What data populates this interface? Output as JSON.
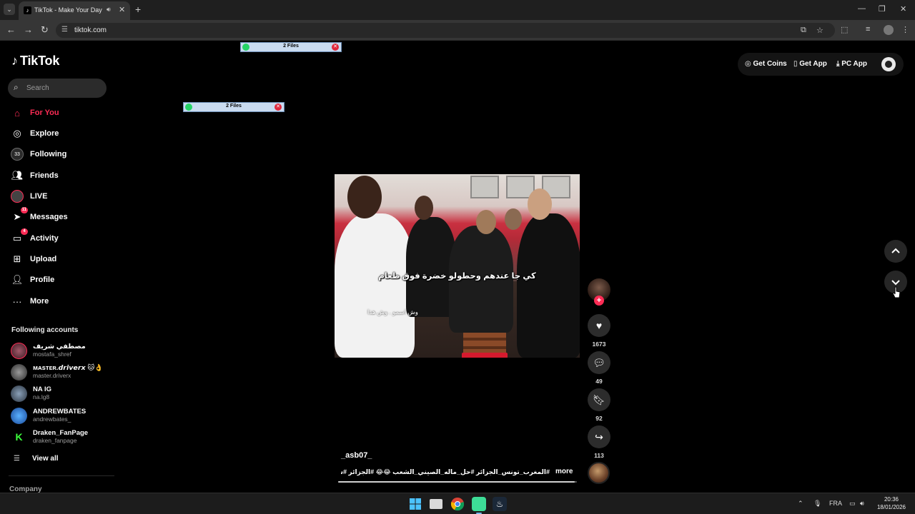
{
  "browser": {
    "tab_title": "TikTok - Make Your Day",
    "url": "tiktok.com"
  },
  "tiktok": {
    "logo_text": "TikTok",
    "search": {
      "placeholder": "Search"
    },
    "nav": [
      {
        "label": "For You",
        "icon": "home-icon"
      },
      {
        "label": "Explore",
        "icon": "compass-icon"
      },
      {
        "label": "Following",
        "icon": "following-icon"
      },
      {
        "label": "Friends",
        "icon": "friends-icon"
      },
      {
        "label": "LIVE",
        "icon": "live-icon"
      },
      {
        "label": "Messages",
        "icon": "messages-icon",
        "badge": "11"
      },
      {
        "label": "Activity",
        "icon": "activity-icon",
        "badge": "4"
      },
      {
        "label": "Upload",
        "icon": "upload-icon"
      },
      {
        "label": "Profile",
        "icon": "profile-icon"
      },
      {
        "label": "More",
        "icon": "more-icon"
      }
    ],
    "following_title": "Following accounts",
    "following": [
      {
        "name": "مصطفي شريف",
        "handle": "mostafa_shref"
      },
      {
        "name": "ᴍᴀsᴛᴇʀ.𝙙𝙧𝙞𝙫𝙚𝙧𝙭 🐱👌",
        "handle": "master.driverx"
      },
      {
        "name": "NA IG",
        "handle": "na.lg8"
      },
      {
        "name": "ANDREWBATES",
        "handle": "andrewbates_"
      },
      {
        "name": "Draken_FanPage",
        "handle": "draken_fanpage"
      }
    ],
    "view_all": "View all",
    "company": "Company",
    "header": {
      "get_coins": "Get Coins",
      "get_app": "Get App",
      "pc_app": "PC App"
    },
    "video": {
      "subtitle_main": "كي جا عندهم وحطولو خضرة فوق طعام",
      "subtitle_small": "وش اسمو . وش هذا",
      "author": "_asb07_",
      "caption": "#المغرب_تونس_الجزائر #حل_ماله_الصيني_الشعب 😂😂 #الجزائر #سيليو...",
      "more": "more",
      "progress": 0.99
    },
    "actions": {
      "likes": "1673",
      "comments": "49",
      "saves": "92",
      "shares": "113"
    }
  },
  "overlays": {
    "files_label": "2 Files"
  },
  "taskbar": {
    "language": "FRA",
    "time": "20:36",
    "date": "18/01/2026"
  }
}
